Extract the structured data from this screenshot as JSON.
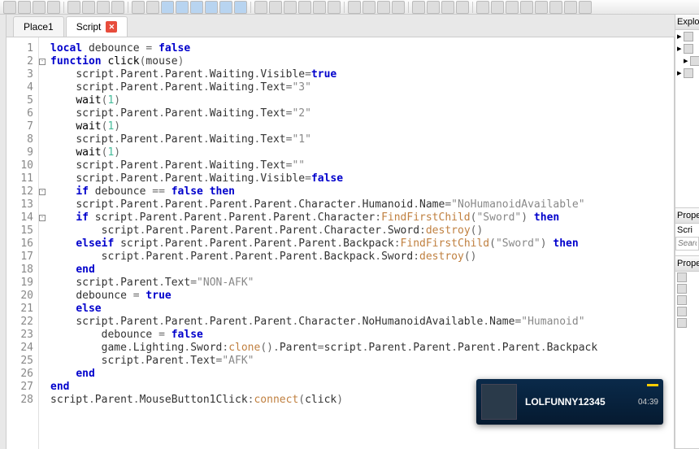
{
  "toolbar": {
    "buttons": 38
  },
  "tabs": [
    {
      "label": "Place1",
      "active": false,
      "close": false
    },
    {
      "label": "Script",
      "active": true,
      "close": true
    }
  ],
  "lines": 28,
  "code": [
    [
      [
        "kw",
        "local"
      ],
      [
        "sp",
        " "
      ],
      [
        "ident",
        "debounce"
      ],
      [
        "sp",
        " "
      ],
      [
        "op",
        "="
      ],
      [
        "sp",
        " "
      ],
      [
        "bool",
        "false"
      ]
    ],
    [
      [
        "kw",
        "function"
      ],
      [
        "sp",
        " "
      ],
      [
        "fn",
        "click"
      ],
      [
        "op",
        "("
      ],
      [
        "ident",
        "mouse"
      ],
      [
        "op",
        ")"
      ]
    ],
    [
      [
        "sp",
        "    "
      ],
      [
        "ident",
        "script"
      ],
      [
        "op",
        "."
      ],
      [
        "prop",
        "Parent"
      ],
      [
        "op",
        "."
      ],
      [
        "prop",
        "Parent"
      ],
      [
        "op",
        "."
      ],
      [
        "prop",
        "Waiting"
      ],
      [
        "op",
        "."
      ],
      [
        "prop",
        "Visible"
      ],
      [
        "op",
        "="
      ],
      [
        "bool",
        "true"
      ]
    ],
    [
      [
        "sp",
        "    "
      ],
      [
        "ident",
        "script"
      ],
      [
        "op",
        "."
      ],
      [
        "prop",
        "Parent"
      ],
      [
        "op",
        "."
      ],
      [
        "prop",
        "Parent"
      ],
      [
        "op",
        "."
      ],
      [
        "prop",
        "Waiting"
      ],
      [
        "op",
        "."
      ],
      [
        "prop",
        "Text"
      ],
      [
        "op",
        "="
      ],
      [
        "str",
        "\"3\""
      ]
    ],
    [
      [
        "sp",
        "    "
      ],
      [
        "fn",
        "wait"
      ],
      [
        "op",
        "("
      ],
      [
        "num",
        "1"
      ],
      [
        "op",
        ")"
      ]
    ],
    [
      [
        "sp",
        "    "
      ],
      [
        "ident",
        "script"
      ],
      [
        "op",
        "."
      ],
      [
        "prop",
        "Parent"
      ],
      [
        "op",
        "."
      ],
      [
        "prop",
        "Parent"
      ],
      [
        "op",
        "."
      ],
      [
        "prop",
        "Waiting"
      ],
      [
        "op",
        "."
      ],
      [
        "prop",
        "Text"
      ],
      [
        "op",
        "="
      ],
      [
        "str",
        "\"2\""
      ]
    ],
    [
      [
        "sp",
        "    "
      ],
      [
        "fn",
        "wait"
      ],
      [
        "op",
        "("
      ],
      [
        "num",
        "1"
      ],
      [
        "op",
        ")"
      ]
    ],
    [
      [
        "sp",
        "    "
      ],
      [
        "ident",
        "script"
      ],
      [
        "op",
        "."
      ],
      [
        "prop",
        "Parent"
      ],
      [
        "op",
        "."
      ],
      [
        "prop",
        "Parent"
      ],
      [
        "op",
        "."
      ],
      [
        "prop",
        "Waiting"
      ],
      [
        "op",
        "."
      ],
      [
        "prop",
        "Text"
      ],
      [
        "op",
        "="
      ],
      [
        "str",
        "\"1\""
      ]
    ],
    [
      [
        "sp",
        "    "
      ],
      [
        "fn",
        "wait"
      ],
      [
        "op",
        "("
      ],
      [
        "num",
        "1"
      ],
      [
        "op",
        ")"
      ]
    ],
    [
      [
        "sp",
        "    "
      ],
      [
        "ident",
        "script"
      ],
      [
        "op",
        "."
      ],
      [
        "prop",
        "Parent"
      ],
      [
        "op",
        "."
      ],
      [
        "prop",
        "Parent"
      ],
      [
        "op",
        "."
      ],
      [
        "prop",
        "Waiting"
      ],
      [
        "op",
        "."
      ],
      [
        "prop",
        "Text"
      ],
      [
        "op",
        "="
      ],
      [
        "str",
        "\"\""
      ]
    ],
    [
      [
        "sp",
        "    "
      ],
      [
        "ident",
        "script"
      ],
      [
        "op",
        "."
      ],
      [
        "prop",
        "Parent"
      ],
      [
        "op",
        "."
      ],
      [
        "prop",
        "Parent"
      ],
      [
        "op",
        "."
      ],
      [
        "prop",
        "Waiting"
      ],
      [
        "op",
        "."
      ],
      [
        "prop",
        "Visible"
      ],
      [
        "op",
        "="
      ],
      [
        "bool",
        "false"
      ]
    ],
    [
      [
        "sp",
        "    "
      ],
      [
        "kw",
        "if"
      ],
      [
        "sp",
        " "
      ],
      [
        "ident",
        "debounce"
      ],
      [
        "sp",
        " "
      ],
      [
        "op",
        "=="
      ],
      [
        "sp",
        " "
      ],
      [
        "bool",
        "false"
      ],
      [
        "sp",
        " "
      ],
      [
        "kw",
        "then"
      ]
    ],
    [
      [
        "sp",
        "    "
      ],
      [
        "ident",
        "script"
      ],
      [
        "op",
        "."
      ],
      [
        "prop",
        "Parent"
      ],
      [
        "op",
        "."
      ],
      [
        "prop",
        "Parent"
      ],
      [
        "op",
        "."
      ],
      [
        "prop",
        "Parent"
      ],
      [
        "op",
        "."
      ],
      [
        "prop",
        "Parent"
      ],
      [
        "op",
        "."
      ],
      [
        "prop",
        "Character"
      ],
      [
        "op",
        "."
      ],
      [
        "prop",
        "Humanoid"
      ],
      [
        "op",
        "."
      ],
      [
        "prop",
        "Name"
      ],
      [
        "op",
        "="
      ],
      [
        "str",
        "\"NoHumanoidAvailable\""
      ]
    ],
    [
      [
        "sp",
        "    "
      ],
      [
        "kw",
        "if"
      ],
      [
        "sp",
        " "
      ],
      [
        "ident",
        "script"
      ],
      [
        "op",
        "."
      ],
      [
        "prop",
        "Parent"
      ],
      [
        "op",
        "."
      ],
      [
        "prop",
        "Parent"
      ],
      [
        "op",
        "."
      ],
      [
        "prop",
        "Parent"
      ],
      [
        "op",
        "."
      ],
      [
        "prop",
        "Parent"
      ],
      [
        "op",
        "."
      ],
      [
        "prop",
        "Character"
      ],
      [
        "op",
        ":"
      ],
      [
        "method",
        "FindFirstChild"
      ],
      [
        "op",
        "("
      ],
      [
        "str",
        "\"Sword\""
      ],
      [
        "op",
        ")"
      ],
      [
        "sp",
        " "
      ],
      [
        "kw",
        "then"
      ]
    ],
    [
      [
        "sp",
        "        "
      ],
      [
        "ident",
        "script"
      ],
      [
        "op",
        "."
      ],
      [
        "prop",
        "Parent"
      ],
      [
        "op",
        "."
      ],
      [
        "prop",
        "Parent"
      ],
      [
        "op",
        "."
      ],
      [
        "prop",
        "Parent"
      ],
      [
        "op",
        "."
      ],
      [
        "prop",
        "Parent"
      ],
      [
        "op",
        "."
      ],
      [
        "prop",
        "Character"
      ],
      [
        "op",
        "."
      ],
      [
        "prop",
        "Sword"
      ],
      [
        "op",
        ":"
      ],
      [
        "method",
        "destroy"
      ],
      [
        "op",
        "("
      ],
      [
        "op",
        ")"
      ]
    ],
    [
      [
        "sp",
        "    "
      ],
      [
        "kw",
        "elseif"
      ],
      [
        "sp",
        " "
      ],
      [
        "ident",
        "script"
      ],
      [
        "op",
        "."
      ],
      [
        "prop",
        "Parent"
      ],
      [
        "op",
        "."
      ],
      [
        "prop",
        "Parent"
      ],
      [
        "op",
        "."
      ],
      [
        "prop",
        "Parent"
      ],
      [
        "op",
        "."
      ],
      [
        "prop",
        "Parent"
      ],
      [
        "op",
        "."
      ],
      [
        "prop",
        "Backpack"
      ],
      [
        "op",
        ":"
      ],
      [
        "method",
        "FindFirstChild"
      ],
      [
        "op",
        "("
      ],
      [
        "str",
        "\"Sword\""
      ],
      [
        "op",
        ")"
      ],
      [
        "sp",
        " "
      ],
      [
        "kw",
        "then"
      ]
    ],
    [
      [
        "sp",
        "        "
      ],
      [
        "ident",
        "script"
      ],
      [
        "op",
        "."
      ],
      [
        "prop",
        "Parent"
      ],
      [
        "op",
        "."
      ],
      [
        "prop",
        "Parent"
      ],
      [
        "op",
        "."
      ],
      [
        "prop",
        "Parent"
      ],
      [
        "op",
        "."
      ],
      [
        "prop",
        "Parent"
      ],
      [
        "op",
        "."
      ],
      [
        "prop",
        "Backpack"
      ],
      [
        "op",
        "."
      ],
      [
        "prop",
        "Sword"
      ],
      [
        "op",
        ":"
      ],
      [
        "method",
        "destroy"
      ],
      [
        "op",
        "("
      ],
      [
        "op",
        ")"
      ]
    ],
    [
      [
        "sp",
        "    "
      ],
      [
        "kw",
        "end"
      ]
    ],
    [
      [
        "sp",
        "    "
      ],
      [
        "ident",
        "script"
      ],
      [
        "op",
        "."
      ],
      [
        "prop",
        "Parent"
      ],
      [
        "op",
        "."
      ],
      [
        "prop",
        "Text"
      ],
      [
        "op",
        "="
      ],
      [
        "str",
        "\"NON-AFK\""
      ]
    ],
    [
      [
        "sp",
        "    "
      ],
      [
        "ident",
        "debounce"
      ],
      [
        "sp",
        " "
      ],
      [
        "op",
        "="
      ],
      [
        "sp",
        " "
      ],
      [
        "bool",
        "true"
      ]
    ],
    [
      [
        "sp",
        "    "
      ],
      [
        "kw",
        "else"
      ]
    ],
    [
      [
        "sp",
        "    "
      ],
      [
        "ident",
        "script"
      ],
      [
        "op",
        "."
      ],
      [
        "prop",
        "Parent"
      ],
      [
        "op",
        "."
      ],
      [
        "prop",
        "Parent"
      ],
      [
        "op",
        "."
      ],
      [
        "prop",
        "Parent"
      ],
      [
        "op",
        "."
      ],
      [
        "prop",
        "Parent"
      ],
      [
        "op",
        "."
      ],
      [
        "prop",
        "Character"
      ],
      [
        "op",
        "."
      ],
      [
        "prop",
        "NoHumanoidAvailable"
      ],
      [
        "op",
        "."
      ],
      [
        "prop",
        "Name"
      ],
      [
        "op",
        "="
      ],
      [
        "str",
        "\"Humanoid\""
      ]
    ],
    [
      [
        "sp",
        "        "
      ],
      [
        "ident",
        "debounce"
      ],
      [
        "sp",
        " "
      ],
      [
        "op",
        "="
      ],
      [
        "sp",
        " "
      ],
      [
        "bool",
        "false"
      ]
    ],
    [
      [
        "sp",
        "        "
      ],
      [
        "ident",
        "game"
      ],
      [
        "op",
        "."
      ],
      [
        "prop",
        "Lighting"
      ],
      [
        "op",
        "."
      ],
      [
        "prop",
        "Sword"
      ],
      [
        "op",
        ":"
      ],
      [
        "method",
        "clone"
      ],
      [
        "op",
        "("
      ],
      [
        "op",
        ")"
      ],
      [
        "op",
        "."
      ],
      [
        "prop",
        "Parent"
      ],
      [
        "op",
        "="
      ],
      [
        "ident",
        "script"
      ],
      [
        "op",
        "."
      ],
      [
        "prop",
        "Parent"
      ],
      [
        "op",
        "."
      ],
      [
        "prop",
        "Parent"
      ],
      [
        "op",
        "."
      ],
      [
        "prop",
        "Parent"
      ],
      [
        "op",
        "."
      ],
      [
        "prop",
        "Parent"
      ],
      [
        "op",
        "."
      ],
      [
        "prop",
        "Backpack"
      ]
    ],
    [
      [
        "sp",
        "        "
      ],
      [
        "ident",
        "script"
      ],
      [
        "op",
        "."
      ],
      [
        "prop",
        "Parent"
      ],
      [
        "op",
        "."
      ],
      [
        "prop",
        "Text"
      ],
      [
        "op",
        "="
      ],
      [
        "str",
        "\"AFK\""
      ]
    ],
    [
      [
        "sp",
        "    "
      ],
      [
        "kw",
        "end"
      ]
    ],
    [
      [
        "kw",
        "end"
      ]
    ],
    [
      [
        "ident",
        "script"
      ],
      [
        "op",
        "."
      ],
      [
        "prop",
        "Parent"
      ],
      [
        "op",
        "."
      ],
      [
        "prop",
        "MouseButton1Click"
      ],
      [
        "op",
        ":"
      ],
      [
        "method",
        "connect"
      ],
      [
        "op",
        "("
      ],
      [
        "ident",
        "click"
      ],
      [
        "op",
        ")"
      ]
    ]
  ],
  "fold_marks": [
    2,
    12,
    14
  ],
  "panels": {
    "explorer": "Explor",
    "properties": "Prope",
    "script": "Scri",
    "search_placeholder": "Searc",
    "prop2": "Prope"
  },
  "notif": {
    "user": "LOLFUNNY12345",
    "time": "04:39"
  }
}
